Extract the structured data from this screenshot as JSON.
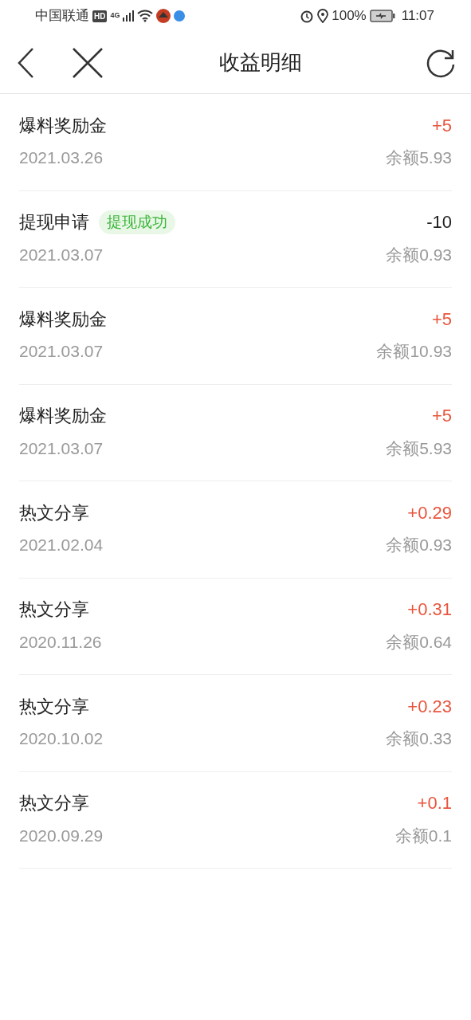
{
  "status_bar": {
    "carrier": "中国联通",
    "hd": "HD",
    "network": "4G",
    "battery": "100%",
    "time": "11:07"
  },
  "header": {
    "title": "收益明细"
  },
  "records": [
    {
      "title": "爆料奖励金",
      "date": "2021.03.26",
      "amount": "+5",
      "kind": "income",
      "balance": "余额5.93"
    },
    {
      "title": "提现申请",
      "badge": "提现成功",
      "date": "2021.03.07",
      "amount": "-10",
      "kind": "expense",
      "balance": "余额0.93"
    },
    {
      "title": "爆料奖励金",
      "date": "2021.03.07",
      "amount": "+5",
      "kind": "income",
      "balance": "余额10.93"
    },
    {
      "title": "爆料奖励金",
      "date": "2021.03.07",
      "amount": "+5",
      "kind": "income",
      "balance": "余额5.93"
    },
    {
      "title": "热文分享",
      "date": "2021.02.04",
      "amount": "+0.29",
      "kind": "income",
      "balance": "余额0.93"
    },
    {
      "title": "热文分享",
      "date": "2020.11.26",
      "amount": "+0.31",
      "kind": "income",
      "balance": "余额0.64"
    },
    {
      "title": "热文分享",
      "date": "2020.10.02",
      "amount": "+0.23",
      "kind": "income",
      "balance": "余额0.33"
    },
    {
      "title": "热文分享",
      "date": "2020.09.29",
      "amount": "+0.1",
      "kind": "income",
      "balance": "余额0.1"
    }
  ]
}
